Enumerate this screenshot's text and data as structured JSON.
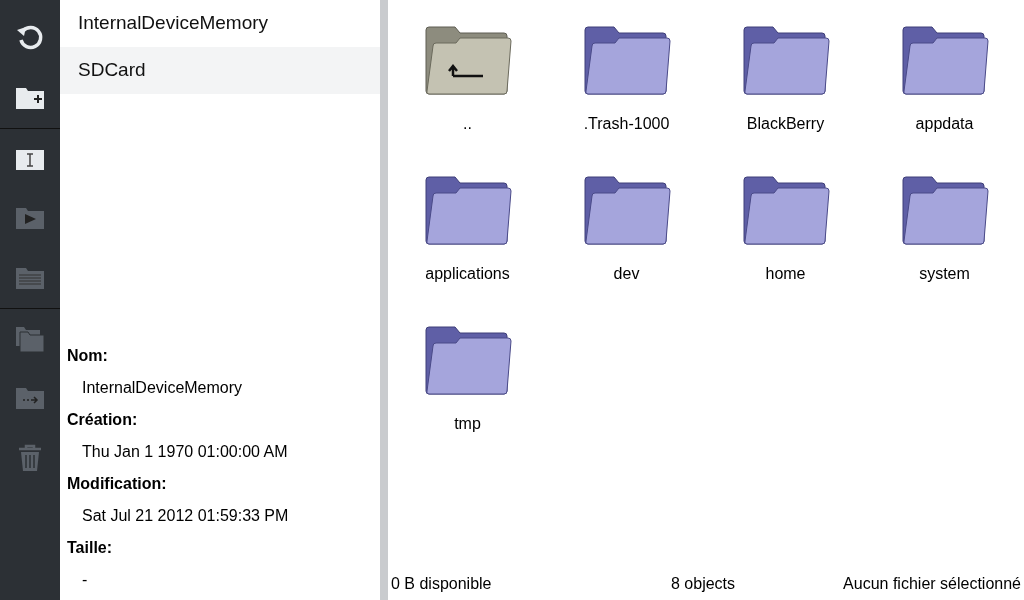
{
  "toolbar": [
    {
      "kind": "refresh",
      "disabled": false
    },
    {
      "kind": "new-folder",
      "disabled": false
    },
    {
      "kind": "rename",
      "disabled": false
    },
    {
      "kind": "open",
      "disabled": true
    },
    {
      "kind": "properties",
      "disabled": true
    },
    {
      "kind": "copy",
      "disabled": true
    },
    {
      "kind": "move",
      "disabled": true
    },
    {
      "kind": "delete",
      "disabled": true
    }
  ],
  "locations": [
    {
      "label": "InternalDeviceMemory",
      "selected": false
    },
    {
      "label": "SDCard",
      "selected": true
    }
  ],
  "details": [
    {
      "label": "Nom:",
      "value": "InternalDeviceMemory"
    },
    {
      "label": "Création:",
      "value": "Thu Jan 1 1970 01:00:00 AM"
    },
    {
      "label": "Modification:",
      "value": "Sat Jul 21 2012 01:59:33 PM"
    },
    {
      "label": "Taille:",
      "value": "-"
    }
  ],
  "files": [
    {
      "name": "..",
      "kind": "parent"
    },
    {
      "name": ".Trash-1000",
      "kind": "folder"
    },
    {
      "name": "BlackBerry",
      "kind": "folder"
    },
    {
      "name": "appdata",
      "kind": "folder"
    },
    {
      "name": "applications",
      "kind": "folder"
    },
    {
      "name": "dev",
      "kind": "folder"
    },
    {
      "name": "home",
      "kind": "folder"
    },
    {
      "name": "system",
      "kind": "folder"
    },
    {
      "name": "tmp",
      "kind": "folder"
    }
  ],
  "status_bar": {
    "free": "0 B disponible",
    "count": "8 objects",
    "selection": "Aucun fichier sélectionné"
  }
}
